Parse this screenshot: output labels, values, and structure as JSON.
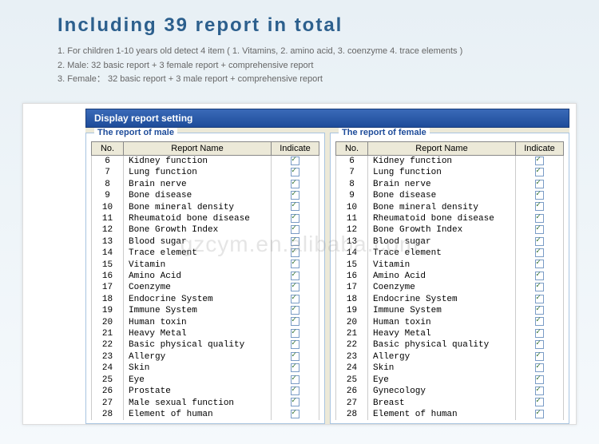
{
  "header": {
    "title": "Including 39 report in total",
    "line1": "1. For children 1-10 years old detect 4 item ( 1. Vitamins, 2. amino acid, 3. coenzyme 4. trace elements )",
    "line2": "2. Male: 32 basic report + 3 female report + comprehensive report",
    "line3": "3. Female： 32 basic report + 3 male report + comprehensive report"
  },
  "window": {
    "title": "Display report setting"
  },
  "columns": {
    "no": "No.",
    "name": "Report Name",
    "indicate": "Indicate"
  },
  "male": {
    "legend": "The report of male",
    "rows": [
      {
        "no": "6",
        "name": "Kidney function"
      },
      {
        "no": "7",
        "name": "Lung function"
      },
      {
        "no": "8",
        "name": "Brain nerve"
      },
      {
        "no": "9",
        "name": "Bone disease"
      },
      {
        "no": "10",
        "name": "Bone mineral density"
      },
      {
        "no": "11",
        "name": "Rheumatoid bone disease"
      },
      {
        "no": "12",
        "name": "Bone Growth Index"
      },
      {
        "no": "13",
        "name": "Blood sugar"
      },
      {
        "no": "14",
        "name": "Trace element"
      },
      {
        "no": "15",
        "name": "Vitamin"
      },
      {
        "no": "16",
        "name": "Amino Acid"
      },
      {
        "no": "17",
        "name": "Coenzyme"
      },
      {
        "no": "18",
        "name": "Endocrine System"
      },
      {
        "no": "19",
        "name": "Immune System"
      },
      {
        "no": "20",
        "name": "Human toxin"
      },
      {
        "no": "21",
        "name": "Heavy Metal"
      },
      {
        "no": "22",
        "name": "Basic physical quality"
      },
      {
        "no": "23",
        "name": "Allergy"
      },
      {
        "no": "24",
        "name": "Skin"
      },
      {
        "no": "25",
        "name": "Eye"
      },
      {
        "no": "26",
        "name": "Prostate"
      },
      {
        "no": "27",
        "name": "Male sexual function"
      },
      {
        "no": "28",
        "name": "Element of human"
      }
    ]
  },
  "female": {
    "legend": "The report of female",
    "rows": [
      {
        "no": "6",
        "name": "Kidney function"
      },
      {
        "no": "7",
        "name": "Lung function"
      },
      {
        "no": "8",
        "name": "Brain nerve"
      },
      {
        "no": "9",
        "name": "Bone disease"
      },
      {
        "no": "10",
        "name": "Bone mineral density"
      },
      {
        "no": "11",
        "name": "Rheumatoid bone disease"
      },
      {
        "no": "12",
        "name": "Bone Growth Index"
      },
      {
        "no": "13",
        "name": "Blood sugar"
      },
      {
        "no": "14",
        "name": "Trace element"
      },
      {
        "no": "15",
        "name": "Vitamin"
      },
      {
        "no": "16",
        "name": "Amino Acid"
      },
      {
        "no": "17",
        "name": "Coenzyme"
      },
      {
        "no": "18",
        "name": "Endocrine System"
      },
      {
        "no": "19",
        "name": "Immune System"
      },
      {
        "no": "20",
        "name": "Human toxin"
      },
      {
        "no": "21",
        "name": "Heavy Metal"
      },
      {
        "no": "22",
        "name": "Basic physical quality"
      },
      {
        "no": "23",
        "name": "Allergy"
      },
      {
        "no": "24",
        "name": "Skin"
      },
      {
        "no": "25",
        "name": "Eye"
      },
      {
        "no": "26",
        "name": "Gynecology"
      },
      {
        "no": "27",
        "name": "Breast"
      },
      {
        "no": "28",
        "name": "Element of human"
      }
    ]
  },
  "watermark": "gzcym.en.alibaba.com"
}
